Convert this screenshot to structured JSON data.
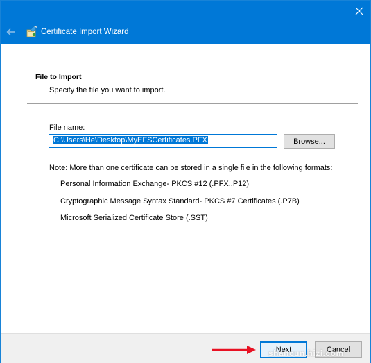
{
  "window": {
    "title": "Certificate Import Wizard"
  },
  "page": {
    "section_title": "File to Import",
    "section_desc": "Specify the file you want to import."
  },
  "form": {
    "file_label": "File name:",
    "file_value": "C:\\Users\\He\\Desktop\\MyEFSCertificates.PFX",
    "browse_label": "Browse..."
  },
  "note": {
    "text": "Note:  More than one certificate can be stored in a single file in the following formats:",
    "formats": [
      "Personal Information Exchange- PKCS #12 (.PFX,.P12)",
      "Cryptographic Message Syntax Standard- PKCS #7 Certificates (.P7B)",
      "Microsoft Serialized Certificate Store (.SST)"
    ]
  },
  "footer": {
    "next_label": "Next",
    "cancel_label": "Cancel",
    "watermark": "shancun.hizi.com"
  },
  "colors": {
    "accent": "#0078d7",
    "arrow": "#e81123"
  },
  "icons": {
    "close": "close-icon",
    "back": "back-arrow-icon",
    "wizard": "certificate-wizard-icon",
    "pointer": "red-arrow-icon"
  }
}
